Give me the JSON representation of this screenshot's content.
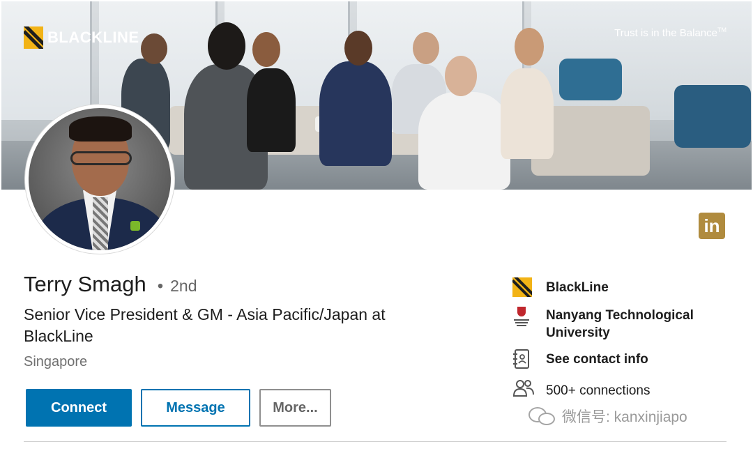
{
  "banner": {
    "brand": "BLACKLINE",
    "tagline": "Trust is in the Balance",
    "tagline_mark": "TM"
  },
  "profile": {
    "name": "Terry Smagh",
    "degree": "2nd",
    "headline": "Senior Vice President & GM - Asia Pacific/Japan at BlackLine",
    "location": "Singapore"
  },
  "actions": {
    "connect": "Connect",
    "message": "Message",
    "more": "More..."
  },
  "linkedin_badge": "in",
  "side": {
    "company": "BlackLine",
    "school": "Nanyang Technological University",
    "contact": "See contact info",
    "connections": "500+ connections"
  },
  "watermark": "微信号: kanxinjiapo",
  "colors": {
    "primary": "#0073b1",
    "blackline_yellow": "#f2b316",
    "linkedin_gold": "#b08b3e"
  }
}
